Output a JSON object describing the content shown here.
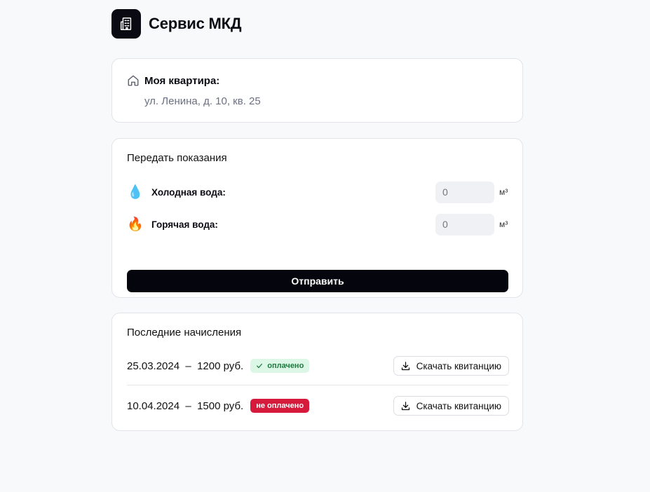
{
  "app": {
    "title": "Сервис МКД",
    "logo_icon": "building-icon"
  },
  "apartment": {
    "label": "Моя квартира:",
    "address": "ул. Ленина, д. 10, кв. 25",
    "icon": "home-icon"
  },
  "readings": {
    "title": "Передать показания",
    "cold": {
      "emoji": "💧",
      "label": "Холодная вода:",
      "value": "",
      "placeholder": "0",
      "unit": "м³"
    },
    "hot": {
      "emoji": "🔥",
      "label": "Горячая вода:",
      "value": "",
      "placeholder": "0",
      "unit": "м³"
    },
    "submit_label": "Отправить"
  },
  "charges": {
    "title": "Последние начисления",
    "items": [
      {
        "text": "25.03.2024  –  1200 руб.",
        "status": "оплачено",
        "status_type": "paid",
        "download_label": "Скачать квитанцию"
      },
      {
        "text": "10.04.2024  –  1500 руб.",
        "status": "не оплачено",
        "status_type": "unpaid",
        "download_label": "Скачать квитанцию"
      }
    ]
  },
  "colors": {
    "background": "#f8f9fb",
    "primary": "#05050d",
    "paid_bg": "#dcf7e6",
    "paid_text": "#1c7a3e",
    "unpaid_bg": "#d61a3c"
  }
}
